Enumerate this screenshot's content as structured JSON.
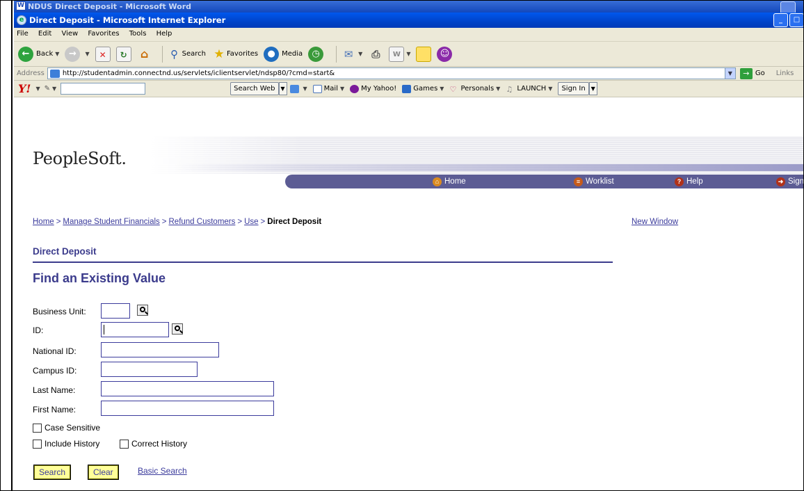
{
  "word": {
    "title": "NDUS Direct Deposit - Microsoft Word"
  },
  "ie": {
    "title": "Direct Deposit - Microsoft Internet Explorer",
    "menu": [
      "File",
      "Edit",
      "View",
      "Favorites",
      "Tools",
      "Help"
    ],
    "toolbar": {
      "back": "Back",
      "search": "Search",
      "favorites": "Favorites",
      "media": "Media"
    },
    "address": {
      "label": "Address",
      "url": "http://studentadmin.connectnd.us/servlets/iclientservlet/ndsp80/?cmd=start&",
      "go": "Go",
      "links": "Links"
    }
  },
  "yahoo": {
    "search_web": "Search Web",
    "mail": "Mail",
    "my_yahoo": "My Yahoo!",
    "games": "Games",
    "personals": "Personals",
    "launch": "LAUNCH",
    "sign_in": "Sign In"
  },
  "ps": {
    "logo": "PeopleSoft.",
    "nav": {
      "home": "Home",
      "worklist": "Worklist",
      "help": "Help",
      "signout": "Sign"
    },
    "breadcrumb": {
      "home": "Home",
      "manage": "Manage Student Financials",
      "refund": "Refund Customers",
      "use": "Use",
      "current": "Direct Deposit",
      "sep": ">"
    },
    "new_window": "New Window",
    "page_title": "Direct Deposit",
    "find_title": "Find an Existing Value",
    "form": {
      "business_unit": "Business Unit:",
      "id": "ID:",
      "national_id": "National ID:",
      "campus_id": "Campus ID:",
      "last_name": "Last Name:",
      "first_name": "First Name:",
      "case_sensitive": "Case Sensitive",
      "include_history": "Include History",
      "correct_history": "Correct History"
    },
    "buttons": {
      "search": "Search",
      "clear": "Clear",
      "basic_search": "Basic Search"
    }
  }
}
